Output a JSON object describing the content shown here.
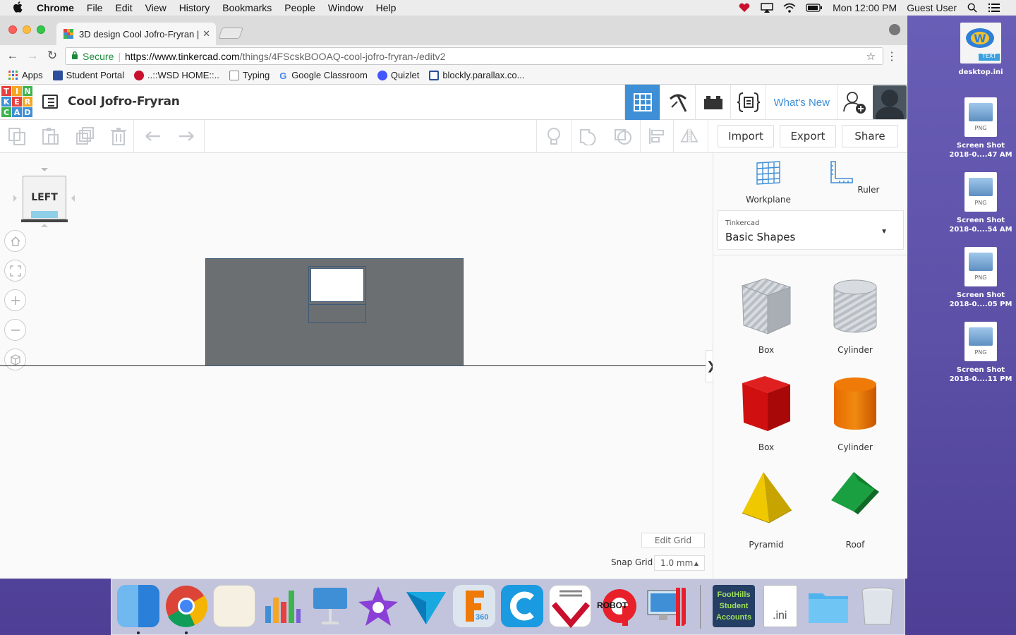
{
  "menubar": {
    "app": "Chrome",
    "items": [
      "File",
      "Edit",
      "View",
      "History",
      "Bookmarks",
      "People",
      "Window",
      "Help"
    ],
    "clock": "Mon 12:00 PM",
    "user": "Guest User"
  },
  "browser": {
    "tab_title": "3D design Cool Jofro-Fryran |",
    "secure_label": "Secure",
    "url_host": "https://www.tinkercad.com",
    "url_path": "/things/4FScskBOOAQ-cool-jofro-fryran-/editv2",
    "bookmarks": [
      "Apps",
      "Student Portal",
      "..::WSD HOME::..",
      "Typing",
      "Google Classroom",
      "Quizlet",
      "blockly.parallax.co..."
    ]
  },
  "tinkercad": {
    "logo_letters": [
      "T",
      "I",
      "N",
      "K",
      "E",
      "R",
      "C",
      "A",
      "D"
    ],
    "logo_colors": [
      "#e8403f",
      "#f5a623",
      "#3fb34f",
      "#3f8fd6",
      "#e8403f",
      "#f5a623",
      "#3fb34f",
      "#3f8fd6",
      "#3f8fd6"
    ],
    "design_title": "Cool Jofro-Fryran",
    "whats_new": "What's New",
    "import_label": "Import",
    "export_label": "Export",
    "share_label": "Share",
    "viewcube_face": "LEFT",
    "edit_grid": "Edit Grid",
    "snap_grid_label": "Snap Grid",
    "snap_grid_value": "1.0 mm",
    "panel": {
      "workplane": "Workplane",
      "ruler": "Ruler",
      "library_source": "Tinkercad",
      "library_name": "Basic Shapes",
      "shapes": [
        "Box",
        "Cylinder",
        "Box",
        "Cylinder",
        "Pyramid",
        "Roof"
      ]
    },
    "accent_color": "#3f8fd6"
  },
  "desktop": {
    "icons": [
      {
        "label": "desktop.ini",
        "tag": "TEXT"
      },
      {
        "label": "Screen Shot 2018-0....47 AM",
        "tag": "PNG"
      },
      {
        "label": "Screen Shot 2018-0....54 AM",
        "tag": "PNG"
      },
      {
        "label": "Screen Shot 2018-0....05 PM",
        "tag": "PNG"
      },
      {
        "label": "Screen Shot 2018-0....11 PM",
        "tag": "PNG"
      }
    ]
  },
  "dock": {
    "apps": [
      "Finder",
      "Chrome",
      "Pages",
      "Numbers",
      "Keynote",
      "iMovie",
      "Vectorworks",
      "Fusion 360",
      "Cengage",
      "Vernier",
      "Robot",
      "Remote Desktop",
      "FootHills Student Accounts",
      "ini",
      "Folder",
      "Trash"
    ],
    "fusion_badge": "360",
    "robot_label": "ROBOT",
    "foothills_label": "FootHills Student Accounts",
    "ini_label": ".ini"
  }
}
